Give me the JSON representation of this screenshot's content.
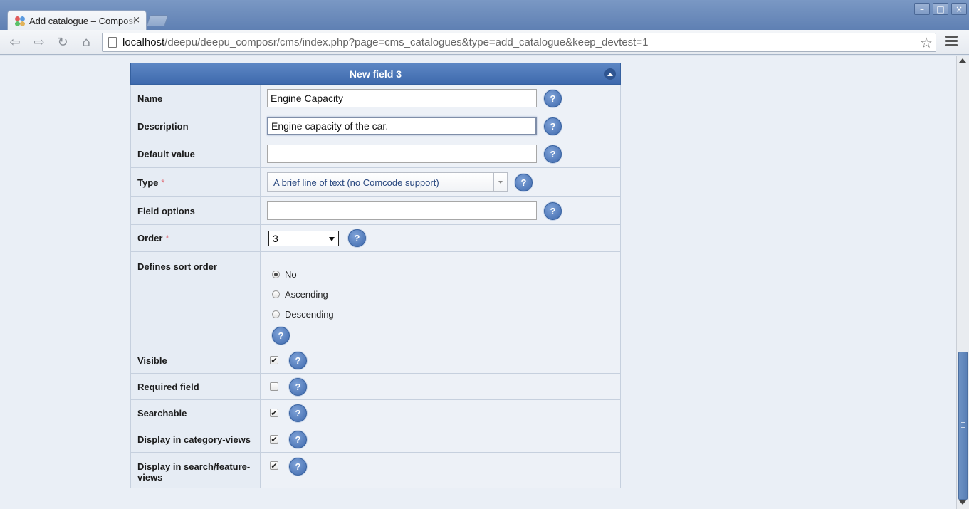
{
  "browser": {
    "tab_title": "Add catalogue – Composr",
    "tab_close": "×",
    "url_host": "localhost",
    "url_path": "/deepu/deepu_composr/cms/index.php?page=cms_catalogues&type=add_catalogue&keep_devtest=1",
    "window_buttons": [
      "–",
      "□",
      "×"
    ],
    "nav_icons": [
      "back-icon",
      "forward-icon",
      "reload-icon",
      "home-icon"
    ]
  },
  "panel": {
    "title": "New field 3",
    "help_glyph": "?",
    "required_mark": "*",
    "fields": {
      "name": {
        "label": "Name",
        "value": "Engine Capacity"
      },
      "description": {
        "label": "Description",
        "value": "Engine capacity of the car."
      },
      "default_value": {
        "label": "Default value",
        "value": ""
      },
      "type": {
        "label": "Type",
        "value": "A brief line of text (no Comcode support)"
      },
      "field_options": {
        "label": "Field options",
        "value": ""
      },
      "order": {
        "label": "Order",
        "value": "3"
      },
      "sort_order": {
        "label": "Defines sort order",
        "options": [
          "No",
          "Ascending",
          "Descending"
        ],
        "selected": "No"
      },
      "visible": {
        "label": "Visible",
        "checked": true
      },
      "required": {
        "label": "Required field",
        "checked": false
      },
      "searchable": {
        "label": "Searchable",
        "checked": true
      },
      "display_category": {
        "label": "Display in category-views",
        "checked": true
      },
      "display_search": {
        "label": "Display in search/feature-views",
        "checked": true
      }
    }
  },
  "colors": {
    "panel_header": "#3e69ad",
    "help_icon": "#3f69ad",
    "required": "#e0707a"
  }
}
